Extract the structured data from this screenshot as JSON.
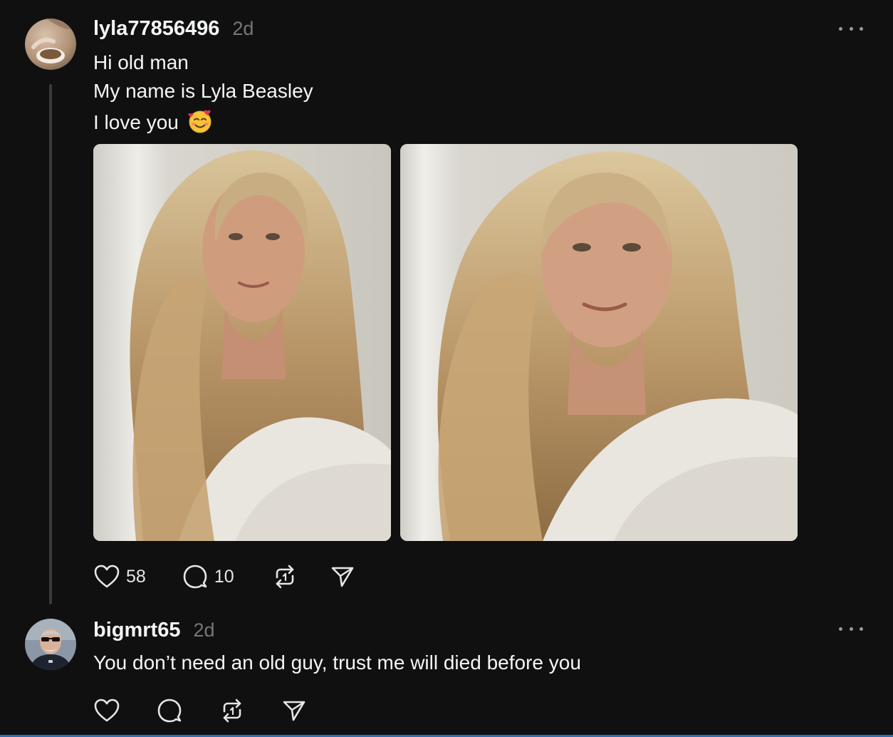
{
  "posts": [
    {
      "username": "lyla77856496",
      "time": "2d",
      "lines": [
        "Hi old man",
        "My name is Lyla Beasley",
        "I love you"
      ],
      "emoji": "smiling-face-with-hearts",
      "likes": "58",
      "replies": "10"
    },
    {
      "username": "bigmrt65",
      "time": "2d",
      "text": "You don’t need an old guy, trust me will died before you"
    }
  ],
  "icons": {
    "like": "heart-icon",
    "reply": "comment-icon",
    "repost": "repost-icon",
    "share": "send-icon",
    "more": "more-options-icon"
  },
  "colors": {
    "background": "#101010",
    "text": "#f3f5f7",
    "secondary": "#777777",
    "thread_line": "#3a3a3a"
  }
}
